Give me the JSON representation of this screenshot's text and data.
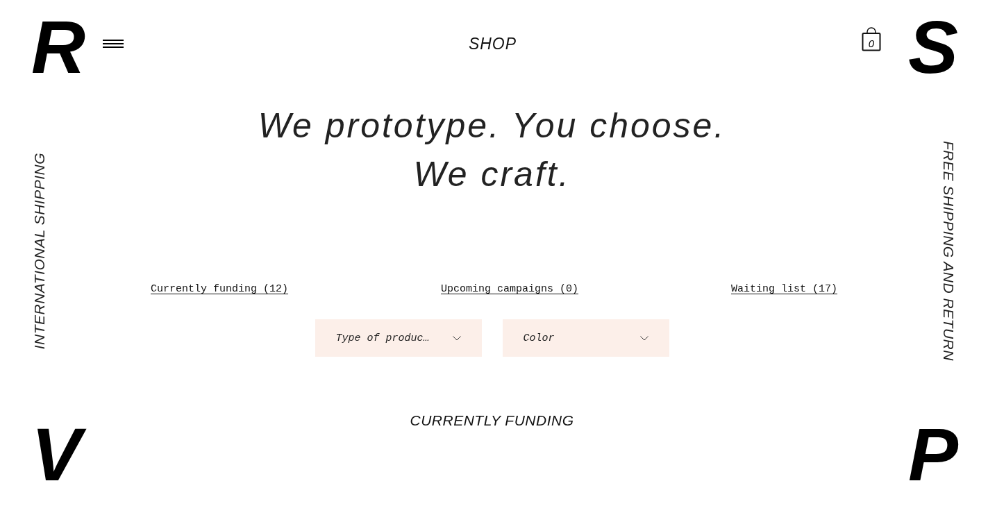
{
  "left_rail": {
    "top_letter": "R",
    "text": "INTERNATIONAL SHIPPING",
    "bottom_letter": "V"
  },
  "right_rail": {
    "top_letter": "S",
    "text": "FREE SHIPPING AND RETURN",
    "bottom_letter": "P"
  },
  "header": {
    "title": "SHOP",
    "cart_count": "0"
  },
  "tagline": [
    "We prototype. You choose.",
    "We craft."
  ],
  "links": [
    {
      "label": "Currently funding (12)"
    },
    {
      "label": "Upcoming campaigns (0)"
    },
    {
      "label": "Waiting list (17)"
    }
  ],
  "filters": [
    {
      "value": "Type of produc…"
    },
    {
      "value": "Color"
    }
  ],
  "section_title": "CURRENTLY FUNDING"
}
